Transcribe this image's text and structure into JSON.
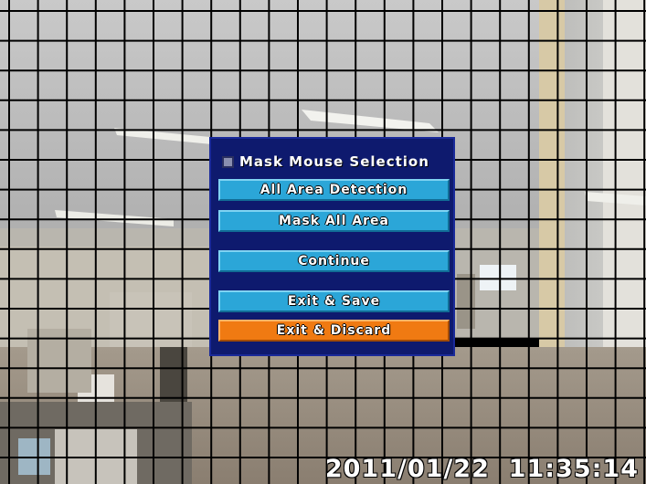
{
  "menu": {
    "title": "Mask Mouse Selection",
    "title_checked": false,
    "buttons": [
      {
        "label": "All Area Detection",
        "selected": false
      },
      {
        "label": "Mask All Area",
        "selected": false
      },
      {
        "label": "Continue",
        "selected": false
      },
      {
        "label": "Exit & Save",
        "selected": false
      },
      {
        "label": "Exit & Discard",
        "selected": true
      }
    ]
  },
  "overlay": {
    "timestamp": "2011/01/22  11:35:14",
    "grid_columns": 22,
    "grid_rows": 16
  },
  "colors": {
    "menu_background": "#0e1a6e",
    "button": "#2ba6d8",
    "button_selected": "#f07a12",
    "grid_line": "#000000"
  }
}
